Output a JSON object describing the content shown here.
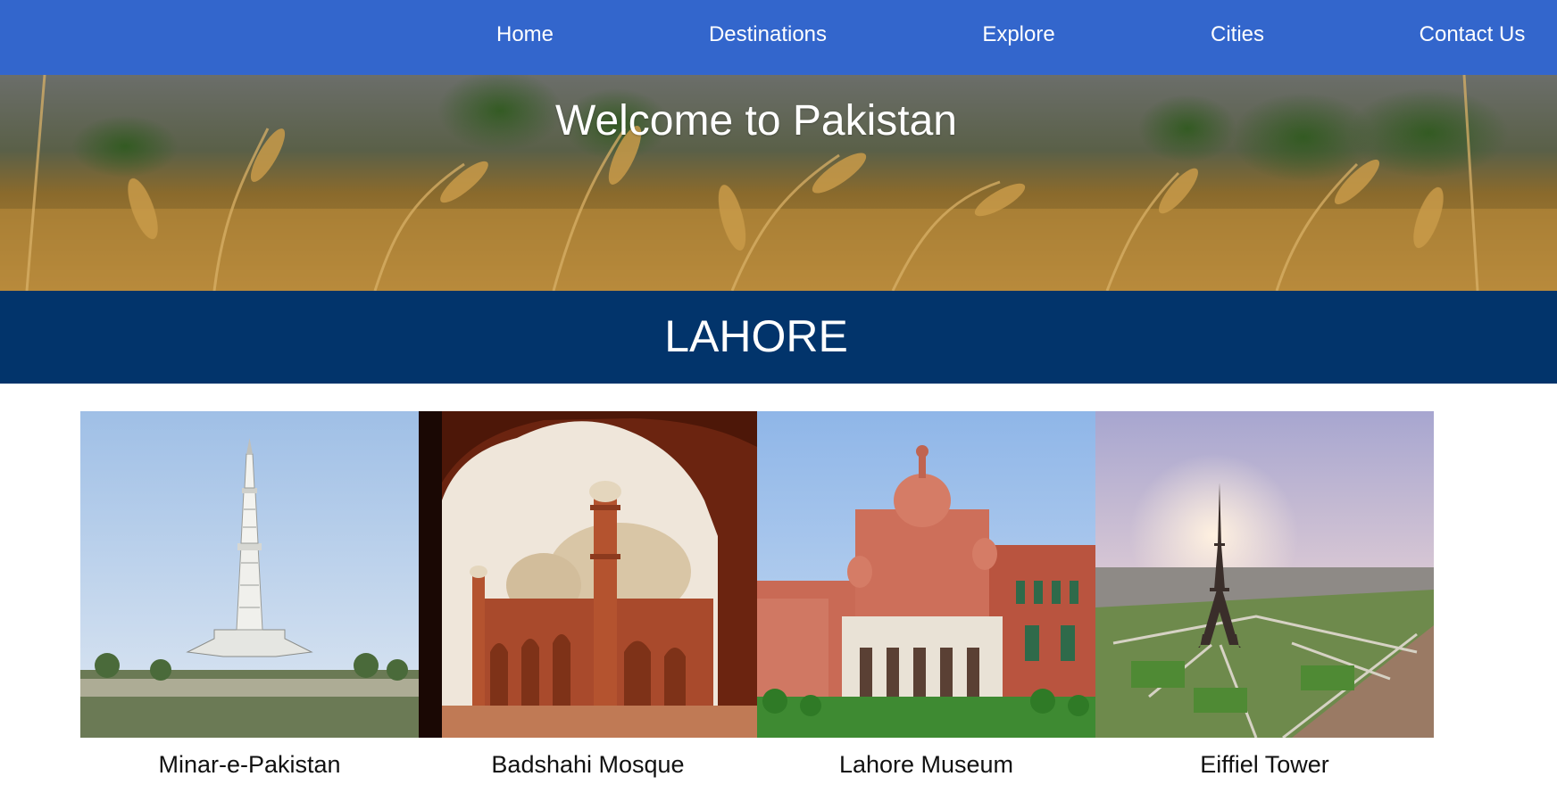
{
  "nav": {
    "items": [
      {
        "label": "Home"
      },
      {
        "label": "Destinations"
      },
      {
        "label": "Explore"
      },
      {
        "label": "Cities"
      },
      {
        "label": "Contact Us"
      }
    ]
  },
  "hero": {
    "title": "Welcome to Pakistan",
    "image": "wheat-field-photo"
  },
  "city": {
    "name": "LAHORE"
  },
  "gallery": {
    "items": [
      {
        "caption": "Minar-e-Pakistan",
        "image": "minar-e-pakistan-photo"
      },
      {
        "caption": "Badshahi Mosque",
        "image": "badshahi-mosque-photo"
      },
      {
        "caption": "Lahore Museum",
        "image": "lahore-museum-photo"
      },
      {
        "caption": "Eiffiel Tower",
        "image": "eiffel-tower-photo"
      }
    ]
  },
  "colors": {
    "nav_background": "#3366cc",
    "city_band_background": "#02346b",
    "text_light": "#ffffff",
    "text_dark": "#111111"
  }
}
